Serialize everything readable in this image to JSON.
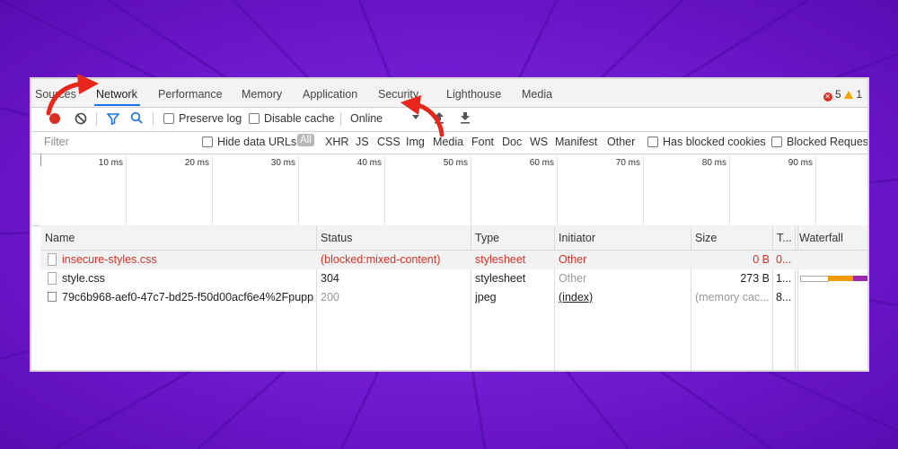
{
  "tabs": [
    "Sources",
    "Network",
    "Performance",
    "Memory",
    "Application",
    "Security",
    "Lighthouse",
    "Media"
  ],
  "issues": {
    "errors": "5",
    "warnings": "1"
  },
  "toolbar": {
    "preserve_log": "Preserve log",
    "disable_cache": "Disable cache",
    "throttling": "Online"
  },
  "filterbar": {
    "placeholder": "Filter",
    "hide_data_urls": "Hide data URLs",
    "all": "All",
    "types": [
      "XHR",
      "JS",
      "CSS",
      "Img",
      "Media",
      "Font",
      "Doc",
      "WS",
      "Manifest",
      "Other"
    ],
    "has_blocked_cookies": "Has blocked cookies",
    "blocked_requests": "Blocked Requests"
  },
  "overview": {
    "ticks": [
      "10 ms",
      "20 ms",
      "30 ms",
      "40 ms",
      "50 ms",
      "60 ms",
      "70 ms",
      "80 ms",
      "90 ms"
    ]
  },
  "table": {
    "headers": [
      "Name",
      "Status",
      "Type",
      "Initiator",
      "Size",
      "T...",
      "Waterfall"
    ],
    "rows": [
      {
        "name": "insecure-styles.css",
        "status": "(blocked:mixed-content)",
        "type": "stylesheet",
        "initiator": "Other",
        "size": "0 B",
        "time": "0..."
      },
      {
        "name": "style.css",
        "status": "304",
        "type": "stylesheet",
        "initiator": "Other",
        "size": "273 B",
        "time": "1..."
      },
      {
        "name": "79c6b968-aef0-47c7-bd25-f50d00acf6e4%2Fpupp...",
        "status": "200",
        "type": "jpeg",
        "initiator": "(index)",
        "size": "(memory cac...",
        "time": "8..."
      }
    ]
  },
  "colors": {
    "background": "#6a12c9",
    "arrow": "#e8261c",
    "record": "#d93025",
    "accent": "#1a73e8"
  }
}
